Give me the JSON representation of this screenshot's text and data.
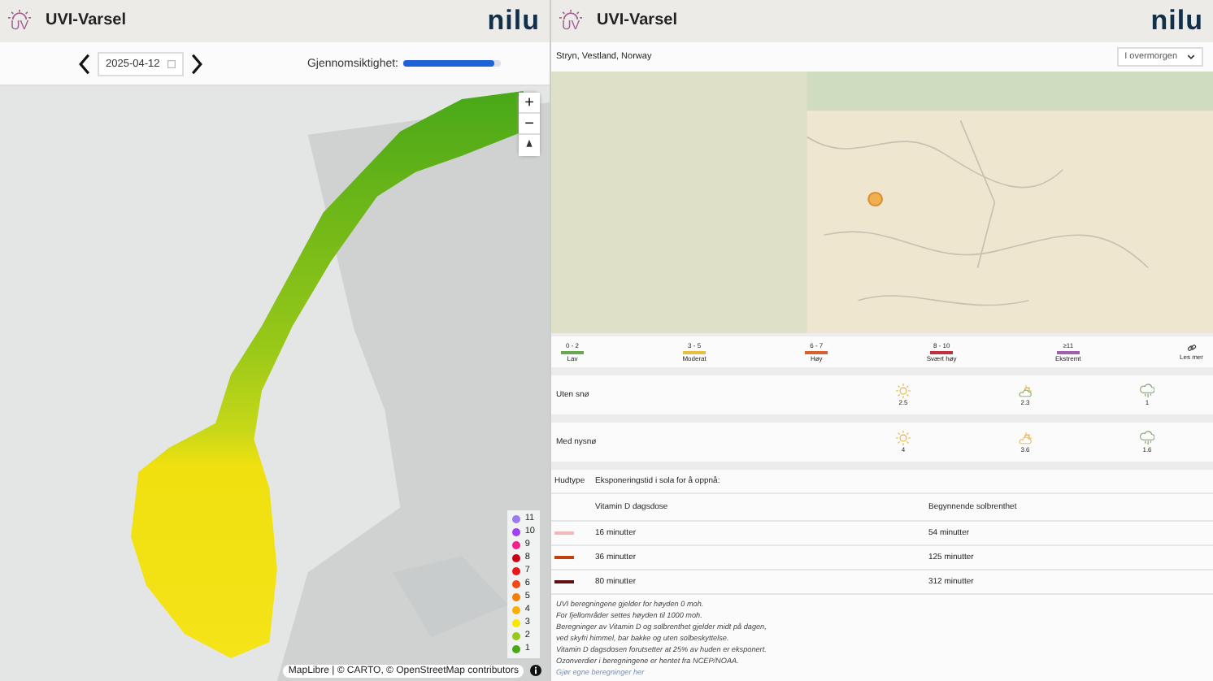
{
  "left": {
    "header": {
      "app_title": "UVI-Varsel",
      "logo_text": "nilu",
      "logo_mark": "UV"
    },
    "date": "2025-04-12",
    "opacity_label": "Gjennomsiktighet:",
    "opacity": {
      "level": 0.93
    },
    "map_controls": [
      "+",
      "−"
    ],
    "scale": [
      {
        "label": "11",
        "color": "#9a7cf0"
      },
      {
        "label": "10",
        "color": "#a040f0"
      },
      {
        "label": "9",
        "color": "#f0208c"
      },
      {
        "label": "8",
        "color": "#c80018"
      },
      {
        "label": "7",
        "color": "#e81818"
      },
      {
        "label": "6",
        "color": "#f04818"
      },
      {
        "label": "5",
        "color": "#f08008"
      },
      {
        "label": "4",
        "color": "#f8b008"
      },
      {
        "label": "3",
        "color": "#f8e800"
      },
      {
        "label": "2",
        "color": "#98c818"
      },
      {
        "label": "1",
        "color": "#48a818"
      }
    ],
    "attribution": "MapLibre | © CARTO, © OpenStreetMap contributors"
  },
  "right": {
    "header": {
      "app_title": "UVI-Varsel",
      "logo_text": "nilu",
      "logo_mark": "UV"
    },
    "location": "Stryn, Vestland, Norway",
    "day": "I overmorgen",
    "categories": [
      {
        "range": "0 - 2",
        "label": "Lav",
        "color": "#6aa84f"
      },
      {
        "range": "3 - 5",
        "label": "Moderat",
        "color": "#e8c040"
      },
      {
        "range": "6 - 7",
        "label": "Høy",
        "color": "#d86030"
      },
      {
        "range": "8 - 10",
        "label": "Svært høy",
        "color": "#c03040"
      },
      {
        "range": "≥11",
        "label": "Ekstremt",
        "color": "#a060b0"
      }
    ],
    "read_more": "Les mer",
    "conditions": [
      {
        "label": "Uten snø",
        "values": [
          {
            "kind": "sun",
            "value": "2.5"
          },
          {
            "kind": "partly",
            "value": "2.3"
          },
          {
            "kind": "cloud",
            "value": "1"
          }
        ]
      },
      {
        "label": "Med nysnø",
        "values": [
          {
            "kind": "sun",
            "value": "4"
          },
          {
            "kind": "partly",
            "value": "3.6"
          },
          {
            "kind": "cloud",
            "value": "1.6"
          }
        ]
      }
    ],
    "table": {
      "col_skin": "Hudtype",
      "col_exposure": "Eksponeringstid i sola for å oppnå:",
      "sub_vitd": "Vitamin D dagsdose",
      "sub_burn": "Begynnende solbrenthet",
      "rows": [
        {
          "color": "#f4b8b8",
          "vitd": "16 minutter",
          "burn": "54 minutter"
        },
        {
          "color": "#c04010",
          "vitd": "36 minutter",
          "burn": "125 minutter"
        },
        {
          "color": "#601010",
          "vitd": "80 minutter",
          "burn": "312 minutter"
        }
      ]
    },
    "notes": [
      "UVI beregningene gjelder for høyden 0 moh.",
      "For fjellområder settes høyden til 1000 moh.",
      "Beregninger av Vitamin D og solbrenthet gjelder midt på dagen,",
      "ved skyfri himmel, bar bakke og uten solbeskyttelse.",
      "Vitamin D dagsdosen forutsetter at 25% av huden er eksponert.",
      "Ozonverdier i beregningene er hentet fra NCEP/NOAA."
    ],
    "link": "Gjør egne beregninger her"
  }
}
